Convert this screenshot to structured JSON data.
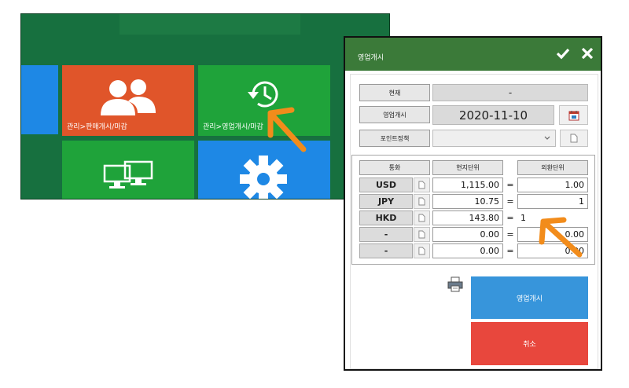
{
  "background_app": {
    "tiles": [
      {
        "label": "",
        "color": "#1e88e5"
      },
      {
        "label": "관리>판매개시/마감",
        "color": "#e0552a",
        "icon": "users-icon"
      },
      {
        "label": "관리>영업개시/마감",
        "color": "#1fa33a",
        "icon": "history-icon"
      },
      {
        "label": "",
        "color": "#1fa33a",
        "icon": "monitors-icon"
      },
      {
        "label": "",
        "color": "#1e88e5",
        "icon": "gear-icon"
      }
    ]
  },
  "dialog": {
    "title": "영업개시",
    "header_color": "#3b7a39",
    "current_label": "현재",
    "current_value": "-",
    "open_label": "영업개시",
    "open_date": "2020-11-10",
    "point_policy_label": "포인트정책",
    "point_policy_value": "",
    "currency_table": {
      "headers": [
        "통화",
        "현지단위",
        "외환단위"
      ],
      "rows": [
        {
          "currency": "USD",
          "local": "1,115.00",
          "eq": "=",
          "foreign": "1.00"
        },
        {
          "currency": "JPY",
          "local": "10.75",
          "eq": "=",
          "foreign": "1"
        },
        {
          "currency": "HKD",
          "local": "143.80",
          "eq": "=",
          "foreign": "1"
        },
        {
          "currency": "-",
          "local": "0.00",
          "eq": "=",
          "foreign": "0.00"
        },
        {
          "currency": "-",
          "local": "0.00",
          "eq": "=",
          "foreign": "0.00"
        }
      ]
    },
    "open_button": "영업개시",
    "open_button_color": "#3795db",
    "cancel_button": "취소",
    "cancel_button_color": "#e8473d"
  },
  "annotation_color": "#f28c1b"
}
